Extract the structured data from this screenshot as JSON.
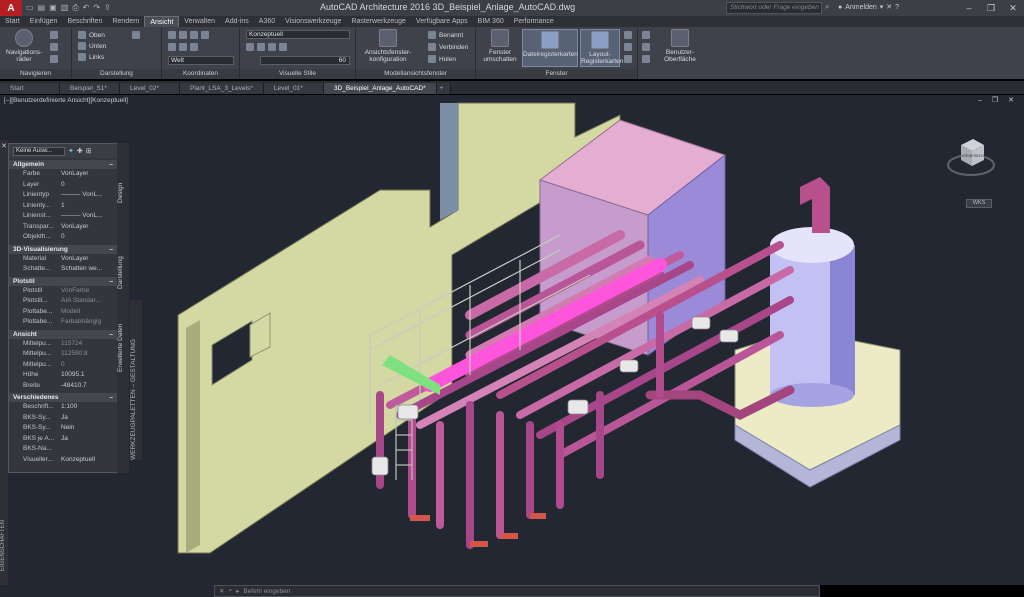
{
  "app": {
    "logo": "A",
    "title": "AutoCAD Architecture 2016     3D_Beispiel_Anlage_AutoCAD.dwg"
  },
  "search": {
    "placeholder": "Stichwort oder Frage eingeben"
  },
  "user": {
    "login_label": "Anmelden"
  },
  "ribbon_tabs": [
    "Start",
    "Einfügen",
    "Beschriften",
    "Rendern",
    "Ansicht",
    "Verwalten",
    "Add-ins",
    "A360",
    "Visionswerkzeuge",
    "Rasterwerkzeuge",
    "Verfügbare Apps",
    "BIM 360",
    "Performance"
  ],
  "active_ribbon_tab": "Ansicht",
  "ribbon": {
    "navigieren": {
      "label": "Navigieren",
      "nav_button": "Navigations-\nräder"
    },
    "darstellung": {
      "label": "Darstellung",
      "oben": "Oben",
      "unten": "Unten",
      "links": "Links"
    },
    "koordinaten": {
      "label": "Koordinaten",
      "welt": "Welt"
    },
    "visuelle_stile": {
      "label": "Visuelle Stile",
      "style": "Konzeptuell",
      "value": "60"
    },
    "modellansichtsfenster": {
      "label": "Modellansichtsfenster",
      "config_btn": "Ansichtsfenster-\nkonfiguration",
      "benannt": "Benannt",
      "verbinden": "Verbinden",
      "holen": "Holen"
    },
    "fenster": {
      "label": "Fenster",
      "umschalten": "Fenster\numschalten",
      "dateireg": "Dateiregisterkarten",
      "layoutreg": "Layout-\nRegisterkarten"
    },
    "benutzer": {
      "label": "Benutzer-\nOberfläche"
    }
  },
  "doc_tabs": [
    "Start",
    "Beispiel_S1*",
    "Level_02*",
    "Plant_LSA_3_Levels*",
    "Level_01*",
    "3D_Beispiel_Anlage_AutoCAD*"
  ],
  "active_doc_tab": "3D_Beispiel_Anlage_AutoCAD*",
  "viewport": {
    "label": "[–][Benutzerdefinierte Ansicht][Konzeptuell]",
    "wks": "WKS"
  },
  "viewcube": {
    "front": "VORNE",
    "right": "RECHTS"
  },
  "properties": {
    "selection": "Keine Ausw...",
    "sections": [
      {
        "title": "Allgemein",
        "rows": [
          {
            "k": "Farbe",
            "v": "VonLayer"
          },
          {
            "k": "Layer",
            "v": "0"
          },
          {
            "k": "Linientyp",
            "v": "——— VonL..."
          },
          {
            "k": "Linienty...",
            "v": "1"
          },
          {
            "k": "Linienst...",
            "v": "——— VonL..."
          },
          {
            "k": "Transpar...",
            "v": "VonLayer"
          },
          {
            "k": "Objekth...",
            "v": "0"
          }
        ]
      },
      {
        "title": "3D-Visualisierung",
        "rows": [
          {
            "k": "Material",
            "v": "VonLayer"
          },
          {
            "k": "Schatte...",
            "v": "Schatten we..."
          }
        ]
      },
      {
        "title": "Plotstil",
        "rows": [
          {
            "k": "Plotstil",
            "v": "VonFarbe"
          },
          {
            "k": "Plotstil...",
            "v": "AIA Standar..."
          },
          {
            "k": "Plottabe...",
            "v": "Modell"
          },
          {
            "k": "Plottabe...",
            "v": "Farbabhängig"
          }
        ]
      },
      {
        "title": "Ansicht",
        "rows": [
          {
            "k": "Mittelpu...",
            "v": "115724"
          },
          {
            "k": "Mittelpu...",
            "v": "112590.8"
          },
          {
            "k": "Mittelpu...",
            "v": "0"
          },
          {
            "k": "Höhe",
            "v": "10095.1"
          },
          {
            "k": "Breite",
            "v": "-48410.7"
          }
        ]
      },
      {
        "title": "Verschiedenes",
        "rows": [
          {
            "k": "Beschrift...",
            "v": "1:100"
          },
          {
            "k": "BKS-Sy...",
            "v": "Ja"
          },
          {
            "k": "BKS-Sy...",
            "v": "Nein"
          },
          {
            "k": "BKS je A...",
            "v": "Ja"
          },
          {
            "k": "BKS-Na...",
            "v": ""
          },
          {
            "k": "Visueller...",
            "v": "Konzeptuell"
          }
        ]
      }
    ],
    "side_tabs": {
      "design": "Design",
      "darstellung": "Darstellung",
      "erweitert": "Erweiterte Daten"
    },
    "palette_label": "WERKZEUGPALETTEN – GESTALTUNG",
    "props_label": "EIGENSCHAFTEN"
  },
  "command_line": {
    "placeholder": "Befehl eingeben"
  },
  "colors": {
    "accent": "#b41e24",
    "pipe": "#a6477e",
    "wall": "#d4d9a4",
    "tank": "#b7b5ee"
  }
}
